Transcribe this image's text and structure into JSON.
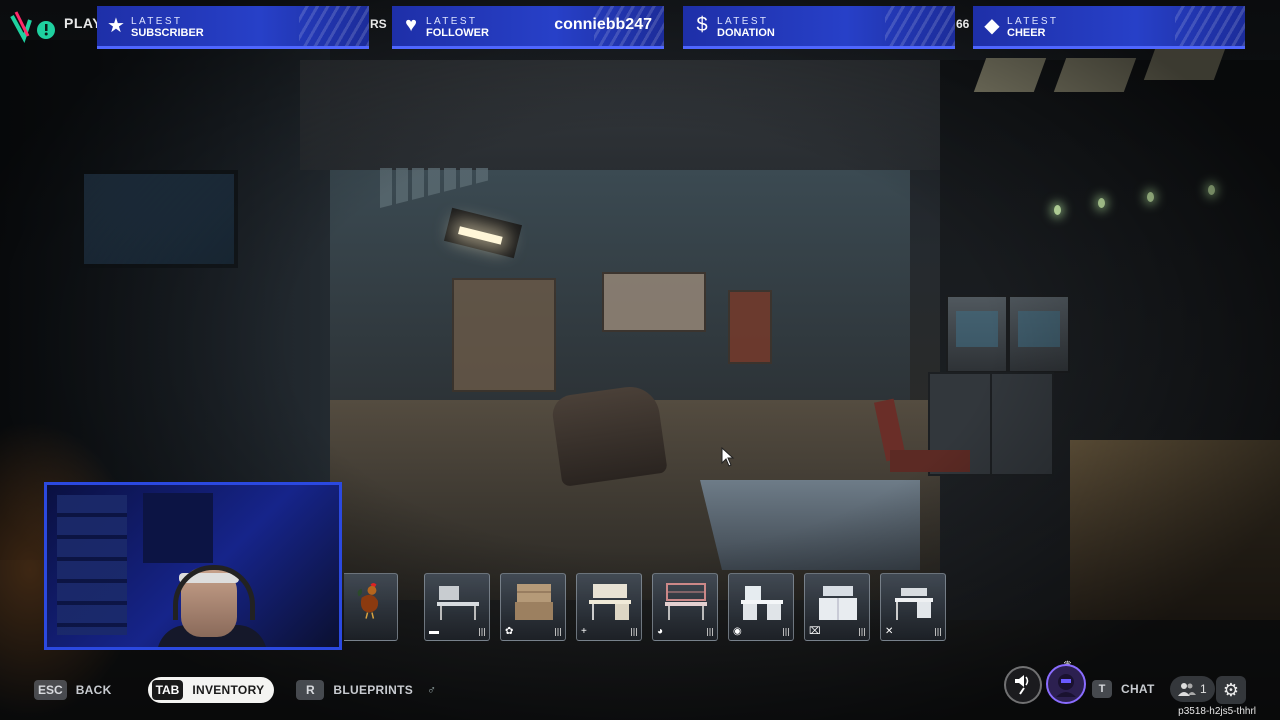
{
  "topbar": {
    "play_label": "PLAY",
    "gap1_text": "RS",
    "gap3_text": "66",
    "alerts": [
      {
        "icon": "star-icon",
        "icon_char": "★",
        "label_top": "LATEST",
        "label_bottom": "SUBSCRIBER",
        "value": ""
      },
      {
        "icon": "heart-icon",
        "icon_char": "♥",
        "label_top": "LATEST",
        "label_bottom": "FOLLOWER",
        "value": "conniebb247"
      },
      {
        "icon": "dollar-icon",
        "icon_char": "$",
        "label_top": "LATEST",
        "label_bottom": "DONATION",
        "value": ""
      },
      {
        "icon": "diamond-icon",
        "icon_char": "◆",
        "label_top": "LATEST",
        "label_bottom": "CHEER",
        "value": ""
      }
    ],
    "accent_color": "#2740c8"
  },
  "inventory_slots": [
    {
      "name": "rooster",
      "category_icon": ""
    },
    {
      "name": "metal-workbench",
      "category_icon": "▬"
    },
    {
      "name": "wooden-hutch",
      "category_icon": "✿"
    },
    {
      "name": "writing-desk",
      "category_icon": "+"
    },
    {
      "name": "shelf-desk",
      "category_icon": "◕"
    },
    {
      "name": "lab-station",
      "category_icon": "◉"
    },
    {
      "name": "cabinet-station",
      "category_icon": "⌧"
    },
    {
      "name": "small-desk",
      "category_icon": "✕"
    }
  ],
  "bottom_bar": {
    "esc_key": "ESC",
    "back_label": "BACK",
    "tab_key": "TAB",
    "inventory_label": "INVENTORY",
    "r_key": "R",
    "blueprints_label": "BLUEPRINTS",
    "blueprints_extra": "♂",
    "t_key": "T",
    "chat_label": "CHAT",
    "player_count": "1",
    "session_id": "p3518-h2js5-thhrl"
  }
}
